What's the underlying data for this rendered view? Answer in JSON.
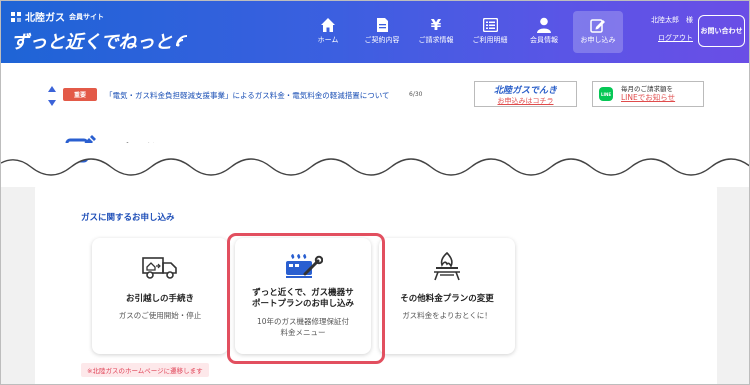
{
  "header": {
    "brand_small": "北陸ガス",
    "brand_sub": "会員サイト",
    "brand_main": "ずっと近くでねっと",
    "nav": [
      {
        "label": "ホーム",
        "icon": "home-icon"
      },
      {
        "label": "ご契約内容",
        "icon": "document-icon"
      },
      {
        "label": "ご請求情報",
        "icon": "yen-icon"
      },
      {
        "label": "ご利用明細",
        "icon": "list-icon"
      },
      {
        "label": "会員情報",
        "icon": "person-icon"
      },
      {
        "label": "お申し込み",
        "icon": "pencil-square-icon"
      }
    ],
    "user_name": "北陸太郎　様",
    "logout": "ログアウト",
    "contact": "お問い合わせ"
  },
  "notice": {
    "tag": "重要",
    "text": "「電気・ガス料金負担軽減支援事業」によるガス料金・電気料金の軽減措置について",
    "date": "6/30",
    "banner1_line1": "北陸ガスでんき",
    "banner1_line2": "お申込みはコチラ",
    "banner2_line1": "毎月のご請求額を",
    "banner2_line2": "LINEでお知らせ",
    "line_label": "LINE"
  },
  "page": {
    "title": "お申し込み",
    "section_title": "ガスに関するお申し込み",
    "cards": [
      {
        "title": "お引越しの手続き",
        "desc": "ガスのご使用開始・停止",
        "icon": "moving-truck-icon"
      },
      {
        "title": "ずっと近くで、ガス機器サポートプランのお申し込み",
        "title_l1": "ずっと近くで、ガス機器サ",
        "title_l2": "ポートプランのお申し込み",
        "desc_l1": "10年のガス機器修理保証付",
        "desc_l2": "料金メニュー",
        "icon": "gas-appliance-wrench-icon"
      },
      {
        "title": "その他料金プランの変更",
        "desc": "ガス料金をよりおとくに！",
        "icon": "gas-burner-icon"
      }
    ],
    "footnote": "※北陸ガスのホームページに遷移します"
  },
  "colors": {
    "header_start": "#1e64d6",
    "header_end": "#6a4ee6",
    "accent_red": "#e24f5f",
    "link_blue": "#1f4fb8"
  }
}
